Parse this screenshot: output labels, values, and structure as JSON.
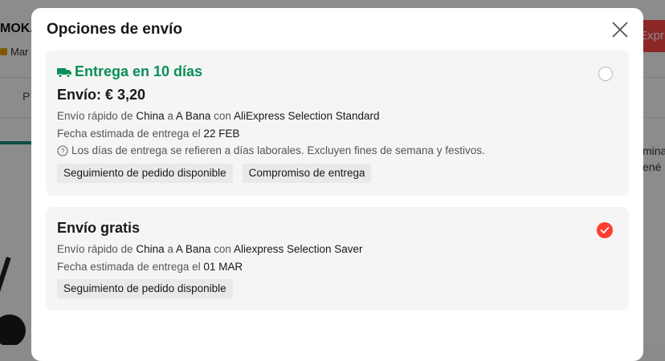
{
  "background": {
    "title": "MOKA",
    "subtitle": "Mar",
    "tab": "P",
    "button": "Expr",
    "side_text": [
      "mina",
      "ené"
    ]
  },
  "modal": {
    "title": "Opciones de envío",
    "close_icon": "close-icon"
  },
  "options": [
    {
      "title": "Entrega en 10 días",
      "price": "Envío: € 3,20",
      "ship_prefix": "Envío rápido de ",
      "origin": "China",
      "to": " a ",
      "destination": "A Bana",
      "carrier_prefix": " con ",
      "carrier": "AliExpress Selection Standard",
      "date_prefix": "Fecha estimada de entrega el ",
      "date": "22 FEB",
      "note": "Los días de entrega se refieren a días laborales. Excluyen fines de semana y festivos.",
      "tags": [
        "Seguimiento de pedido disponible",
        "Compromiso de entrega"
      ],
      "selected": false,
      "accent": "#0a8f58"
    },
    {
      "title": "Envío gratis",
      "ship_prefix": "Envío rápido de ",
      "origin": "China",
      "to": " a ",
      "destination": "A Bana",
      "carrier_prefix": " con ",
      "carrier": "Aliexpress Selection Saver",
      "date_prefix": "Fecha estimada de entrega el ",
      "date": "01 MAR",
      "tags": [
        "Seguimiento de pedido disponible"
      ],
      "selected": true,
      "accent": "#ff3d2e"
    }
  ]
}
